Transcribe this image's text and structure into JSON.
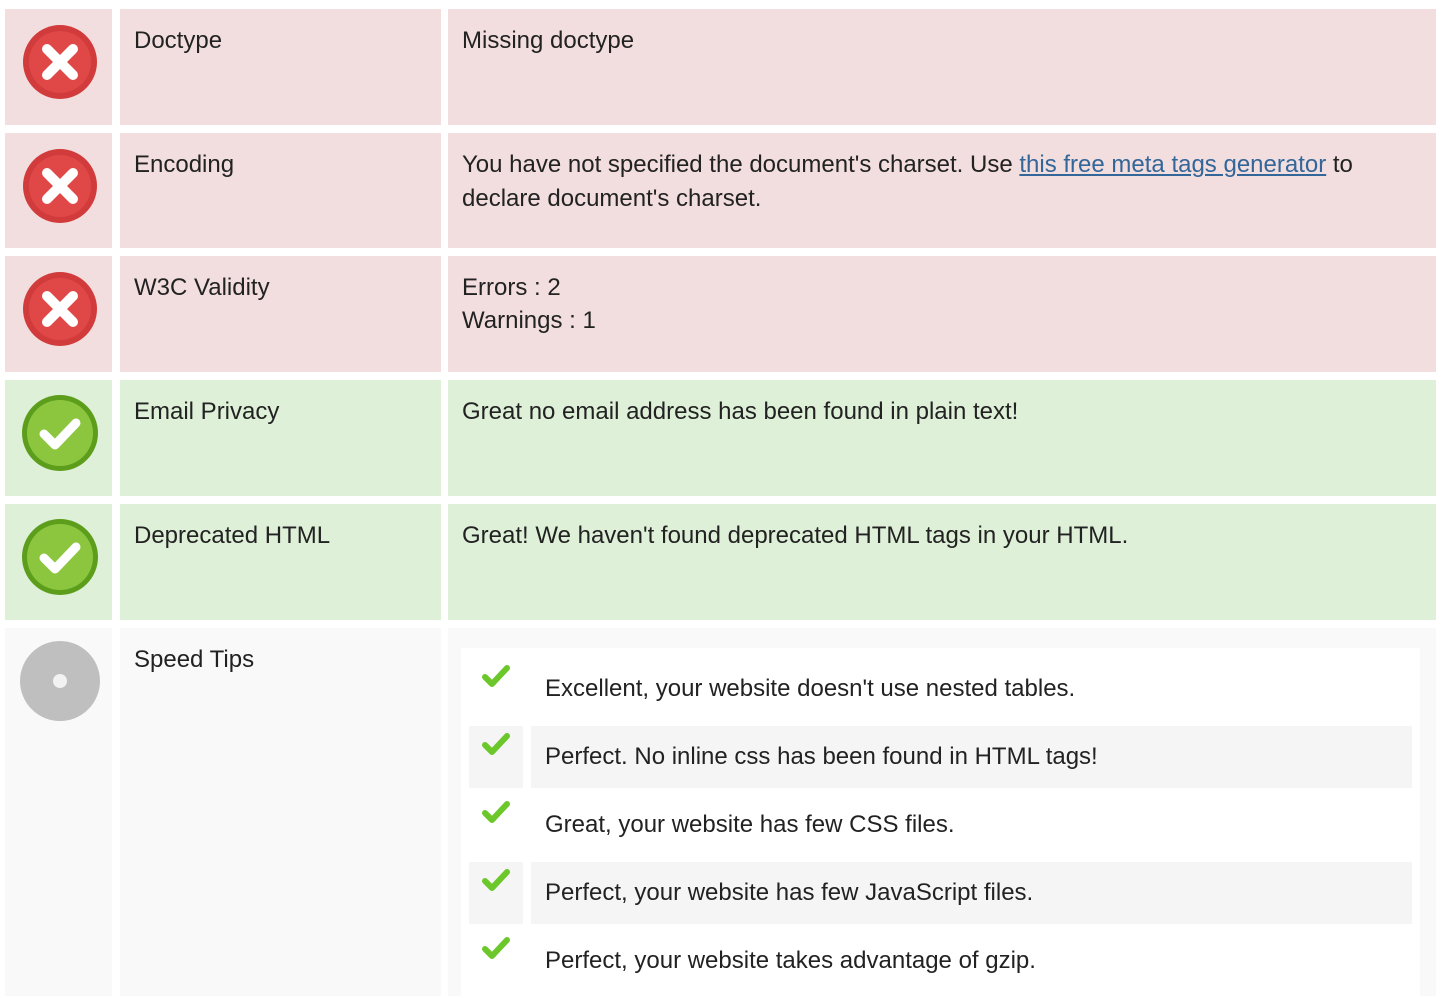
{
  "colors": {
    "error_bg": "#f2dede",
    "success_bg": "#dff0d8",
    "neutral_bg": "#f9f9f9",
    "link": "#336699",
    "check": "#6cc72b"
  },
  "rows": [
    {
      "status": "error",
      "icon": "error-x-icon",
      "label": "Doctype",
      "detail": "Missing doctype"
    },
    {
      "status": "error",
      "icon": "error-x-icon",
      "label": "Encoding",
      "detail_before": "You have not specified the document's charset. Use ",
      "detail_link": "this free meta tags generator",
      "detail_after": " to declare document's charset."
    },
    {
      "status": "error",
      "icon": "error-x-icon",
      "label": "W3C Validity",
      "detail_lines": [
        "Errors : 2",
        "Warnings : 1"
      ]
    },
    {
      "status": "success",
      "icon": "success-check-icon",
      "label": "Email Privacy",
      "detail": "Great no email address has been found in plain text!"
    },
    {
      "status": "success",
      "icon": "success-check-icon",
      "label": "Deprecated HTML",
      "detail": "Great! We haven't found deprecated HTML tags in your HTML."
    },
    {
      "status": "neutral",
      "icon": "neutral-dot-icon",
      "label": "Speed Tips",
      "tips": [
        "Excellent, your website doesn't use nested tables.",
        "Perfect. No inline css has been found in HTML tags!",
        "Great, your website has few CSS files.",
        "Perfect, your website has few JavaScript files.",
        "Perfect, your website takes advantage of gzip."
      ]
    }
  ]
}
